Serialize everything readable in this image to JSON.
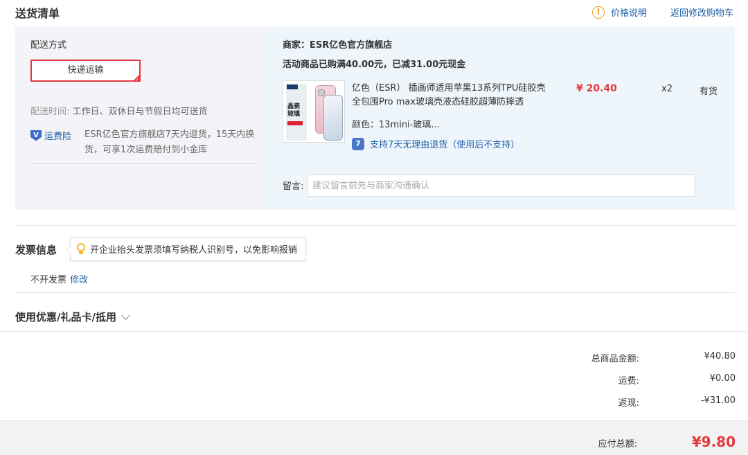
{
  "header": {
    "title": "送货清单",
    "price_note": "价格说明",
    "back_to_cart": "返回修改购物车"
  },
  "shipping": {
    "method_label": "配送方式",
    "method_value": "快递运输",
    "time_label": "配送时间:",
    "time_value": "工作日、双休日与节假日均可送货",
    "insurance_label": "运费险",
    "insurance_desc": "ESR亿色官方旗舰店7天内退货，15天内换货，可享1次运费赔付到小金库"
  },
  "order": {
    "merchant": "商家：ESR亿色官方旗舰店",
    "promo": "活动商品已购满40.00元，已减31.00元现金",
    "product": {
      "image_text": "晶瓷玻璃",
      "name": "亿色（ESR） 插画师适用苹果13系列TPU硅胶壳全包围Pro max玻璃壳液态硅胶超薄防摔透",
      "price": "¥ 20.40",
      "qty": "x2",
      "stock": "有货",
      "color": "颜色：13mini-玻璃...",
      "return_policy": "支持7天无理由退货（使用后不支持）"
    },
    "message_label": "留言:",
    "message_placeholder": "建议留言前先与商家沟通确认"
  },
  "invoice": {
    "title": "发票信息",
    "tip": "开企业抬头发票须填写纳税人识别号，以免影响报销",
    "status": "不开发票",
    "modify": "修改"
  },
  "coupon": {
    "label": "使用优惠/礼品卡/抵用"
  },
  "summary": {
    "goods_total_label": "总商品金额:",
    "goods_total": "¥40.80",
    "shipping_label": "运费:",
    "shipping": "¥0.00",
    "cashback_label": "返现:",
    "cashback": "-¥31.00",
    "payable_label": "应付总额:",
    "payable": "¥9.80"
  },
  "colors": {
    "accent_red": "#e4393c",
    "link_blue": "#1f5fa8"
  }
}
